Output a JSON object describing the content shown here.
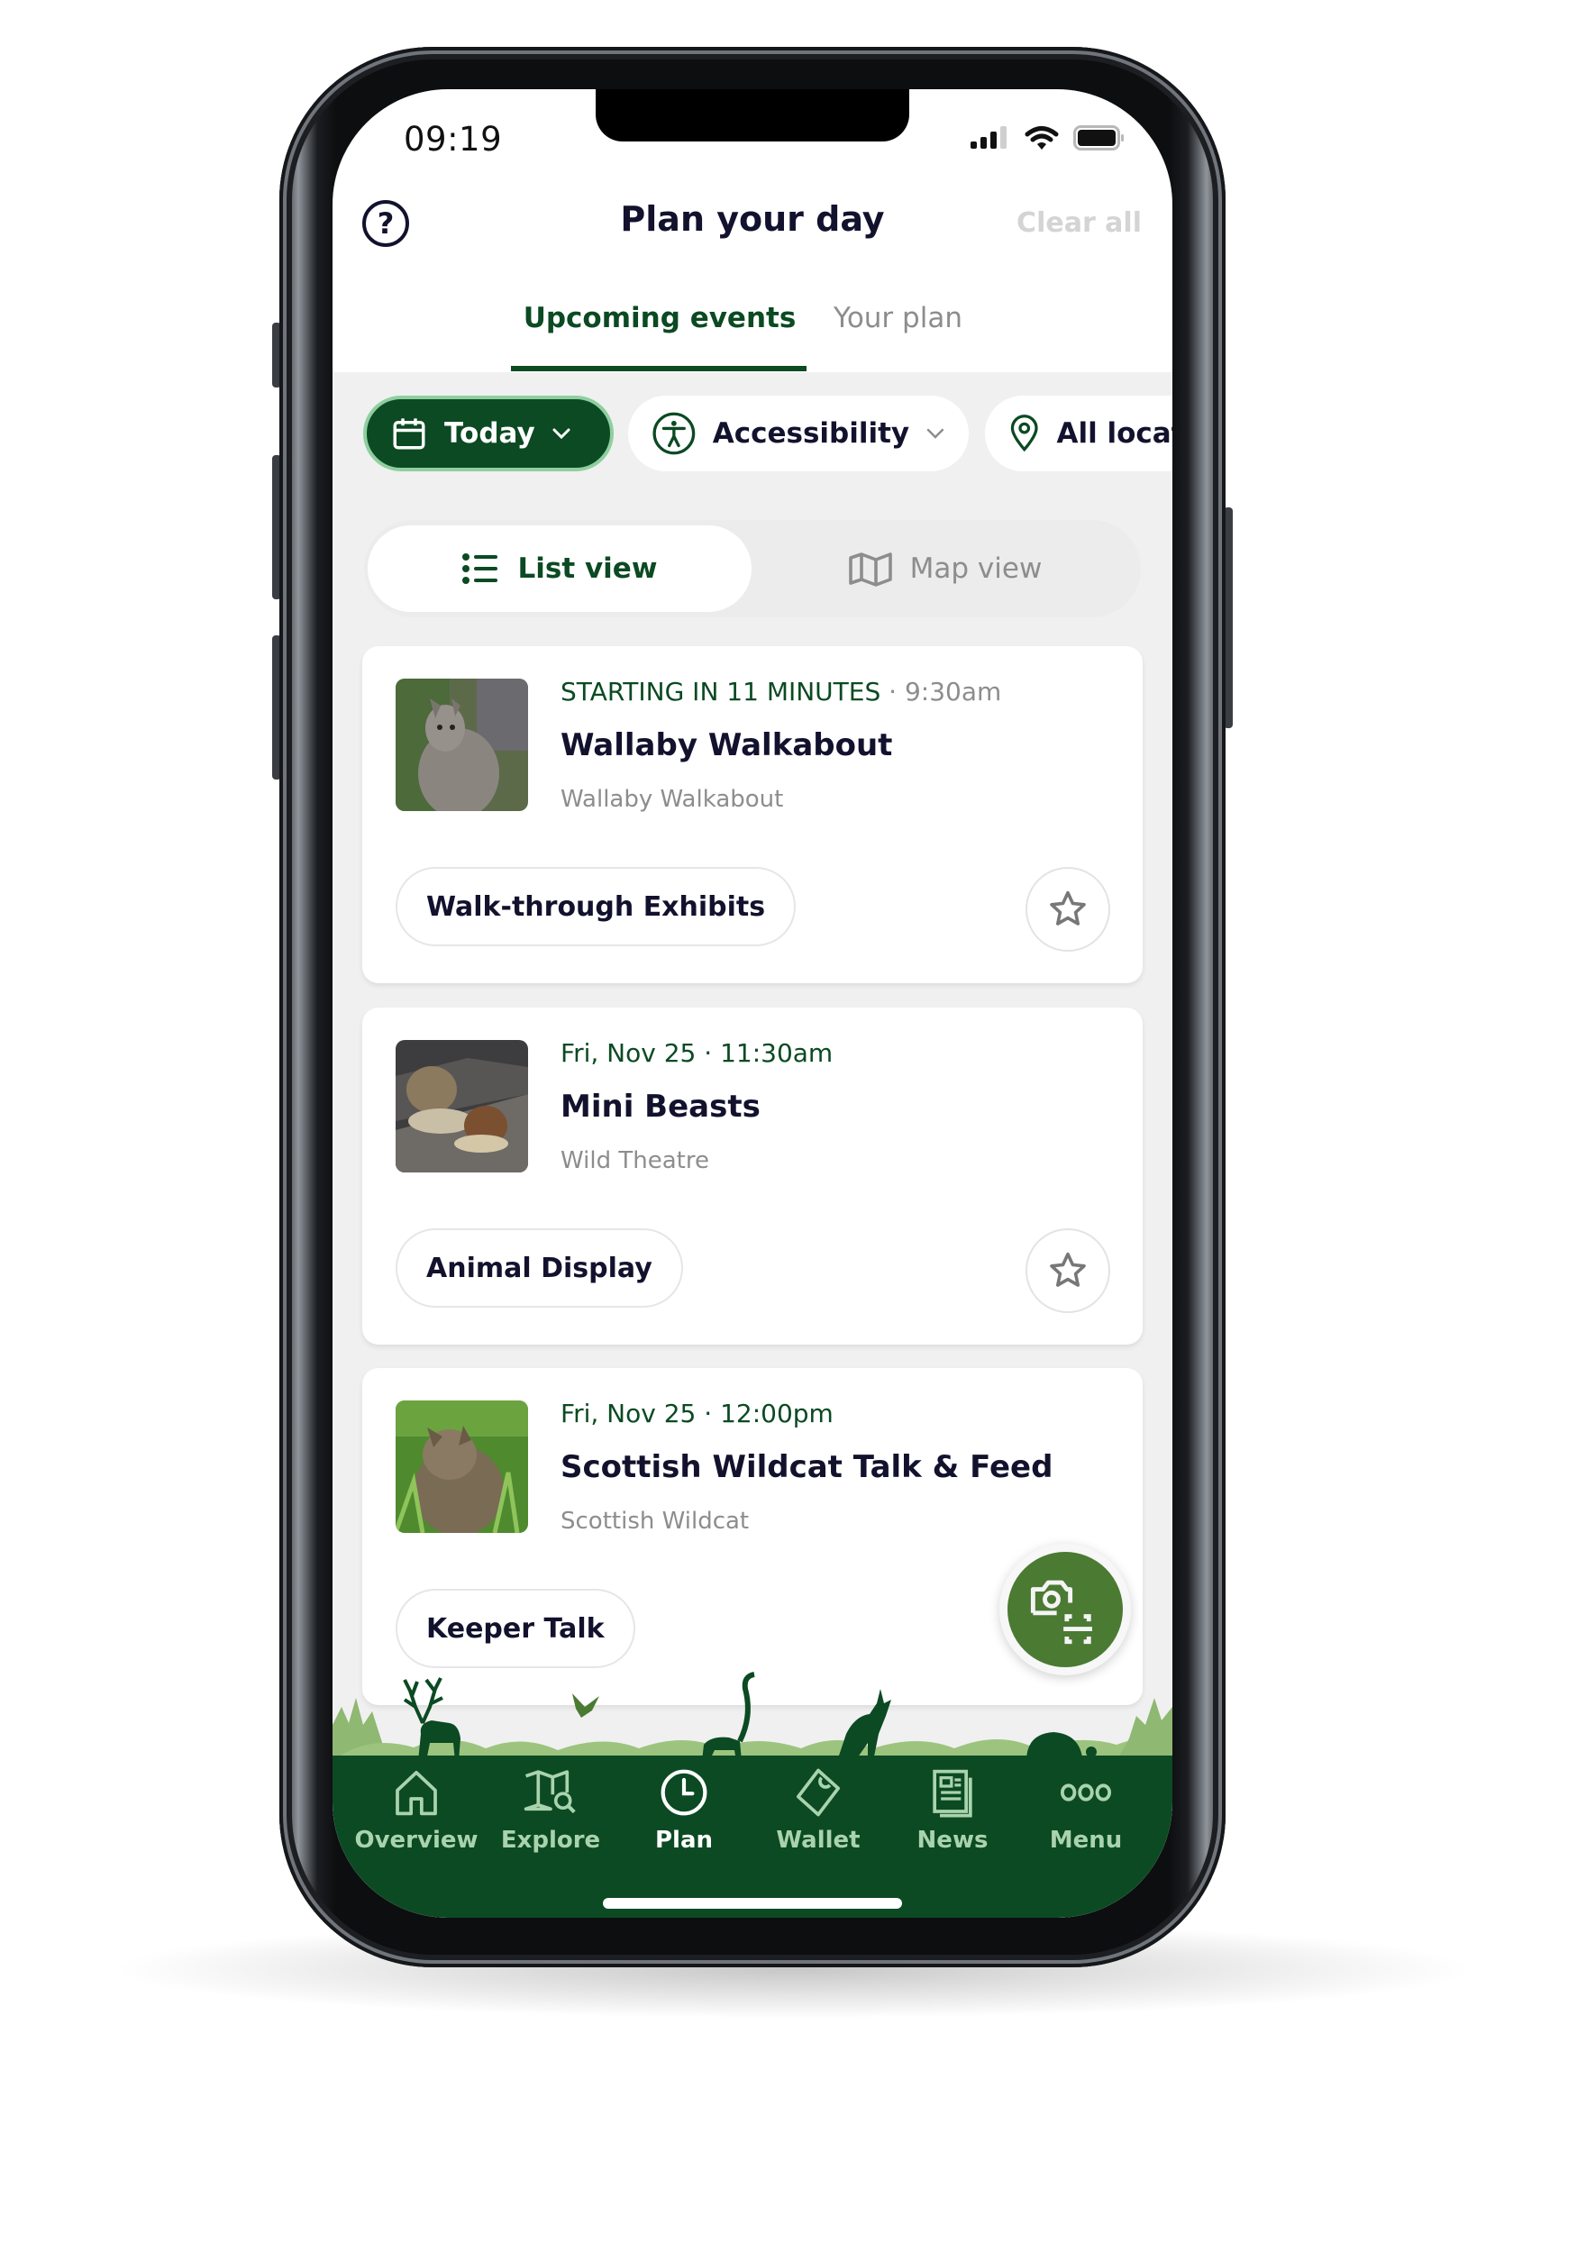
{
  "status_bar": {
    "time": "09:19",
    "signal_bars": 3,
    "signal_max": 4,
    "wifi": true,
    "battery_percent": 100
  },
  "header": {
    "title": "Plan your day",
    "help_icon": "question-circle-icon",
    "clear_all_label": "Clear all"
  },
  "tabs": [
    {
      "label": "Upcoming events",
      "active": true
    },
    {
      "label": "Your plan",
      "active": false
    }
  ],
  "filters": [
    {
      "label": "Today",
      "icon": "calendar-icon",
      "active": true,
      "has_dropdown": true
    },
    {
      "label": "Accessibility",
      "icon": "accessibility-icon",
      "active": false,
      "has_dropdown": true
    },
    {
      "label": "All locations",
      "visible_label": "All loca",
      "icon": "location-pin-icon",
      "active": false
    }
  ],
  "view_toggle": {
    "list_label": "List view",
    "map_label": "Map view",
    "selected": "list"
  },
  "events": [
    {
      "status": "STARTING IN 11 MINUTES",
      "time": "9:30am",
      "title": "Wallaby Walkabout",
      "location": "Wallaby Walkabout",
      "tag": "Walk-through Exhibits",
      "image": "wallaby-photo",
      "favorited": false
    },
    {
      "status": "Fri, Nov 25",
      "time": "11:30am",
      "title": "Mini Beasts",
      "location": "Wild Theatre",
      "tag": "Animal Display",
      "image": "snails-photo",
      "favorited": false
    },
    {
      "status": "Fri, Nov 25",
      "time": "12:00pm",
      "title": "Scottish Wildcat Talk & Feed",
      "location": "Scottish Wildcat",
      "tag": "Keeper Talk",
      "image": "wildcat-photo",
      "favorited": false
    }
  ],
  "fab": {
    "icon": "camera-scan-icon"
  },
  "bottom_nav": [
    {
      "label": "Overview",
      "icon": "home-icon",
      "active": false
    },
    {
      "label": "Explore",
      "icon": "map-search-icon",
      "active": false
    },
    {
      "label": "Plan",
      "icon": "clock-icon",
      "active": true
    },
    {
      "label": "Wallet",
      "icon": "wallet-ticket-icon",
      "active": false
    },
    {
      "label": "News",
      "icon": "newspaper-icon",
      "active": false
    },
    {
      "label": "Menu",
      "icon": "more-dots-icon",
      "active": false
    }
  ],
  "colors": {
    "brand_green": "#0b4a22",
    "fab_green": "#4b7a33",
    "nav_inactive": "#a9d3ad",
    "text_dark": "#12122e",
    "text_muted": "#8d8d8d",
    "background": "#f0f0f0"
  }
}
